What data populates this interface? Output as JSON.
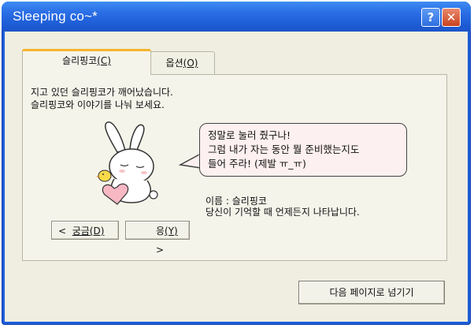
{
  "window": {
    "title": "Sleeping co~*",
    "help_glyph": "?",
    "close_glyph": "✕"
  },
  "tabs": [
    {
      "label": "슬리핑코",
      "accel": "(C)",
      "active": true
    },
    {
      "label": "옵션",
      "accel": "(O)",
      "active": false
    }
  ],
  "intro": {
    "line1": "지고 있던 슬리핑코가 깨어났습니다.",
    "line2": "슬리핑코와 이야기를 나눠 보세요."
  },
  "speech": {
    "line1": "정말로 눌러 줬구나!",
    "line2": "그럼 내가 자는 동안 뭘 준비했는지도",
    "line3": "들어 주라! (제발 ㅠ_ㅠ)"
  },
  "info": {
    "name_line": "이름 : 슬리핑코",
    "desc_line": "당신이 기억할 때 언제든지 나타납니다."
  },
  "nav": {
    "left_arrow": "<",
    "left_label": "궁금",
    "left_accel": "(D)",
    "right_label": "응",
    "right_accel": "(Y)",
    "right_arrow": ">"
  },
  "footer": {
    "next_label": "다음 페이지로 넘기기"
  },
  "colors": {
    "titlebar": "#2b6fe6",
    "client_bg": "#efeee1",
    "close_red": "#c9421e",
    "bubble_bg": "#fdf0f0",
    "tab_highlight": "#f5b52f"
  }
}
